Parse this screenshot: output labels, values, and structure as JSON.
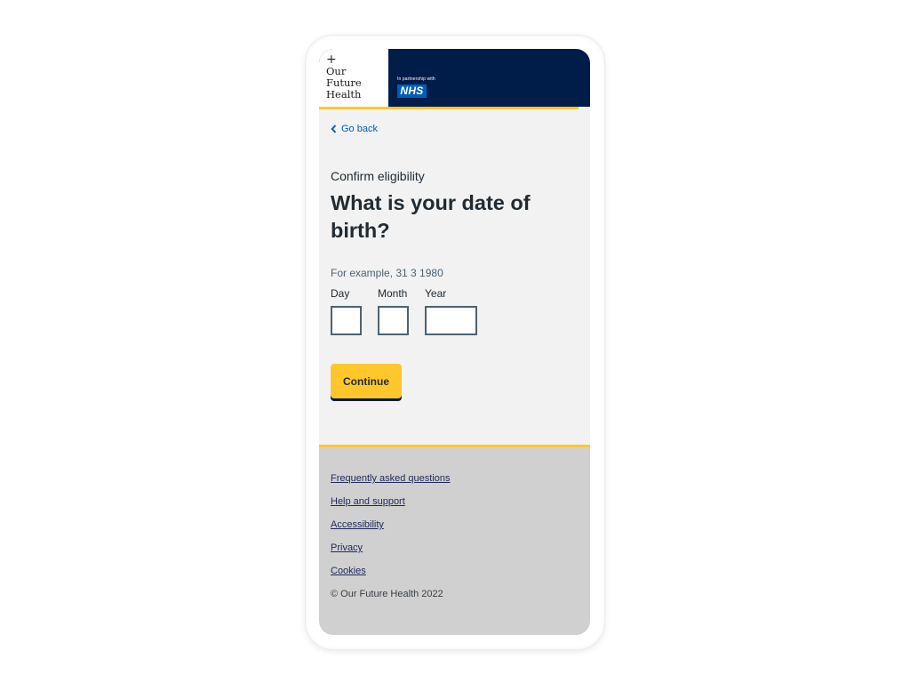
{
  "header": {
    "logo": {
      "symbol": "+",
      "lines": [
        "Our",
        "Future",
        "Health"
      ]
    },
    "partner_text": "In partnership with",
    "partner_logo": "NHS",
    "colors": {
      "navy": "#001c48",
      "accent": "#ffc72c",
      "nhs_blue": "#005eb8"
    }
  },
  "nav": {
    "back_label": "Go back",
    "back_icon": "chevron-left-icon"
  },
  "form": {
    "caption": "Confirm eligibility",
    "heading": "What is your date of birth?",
    "hint": "For example, 31 3 1980",
    "fields": [
      {
        "label": "Day",
        "value": ""
      },
      {
        "label": "Month",
        "value": ""
      },
      {
        "label": "Year",
        "value": ""
      }
    ],
    "submit_label": "Continue"
  },
  "footer": {
    "links": [
      "Frequently asked questions",
      "Help and support",
      "Accessibility",
      "Privacy",
      "Cookies"
    ],
    "copyright": "© Our Future Health 2022"
  }
}
